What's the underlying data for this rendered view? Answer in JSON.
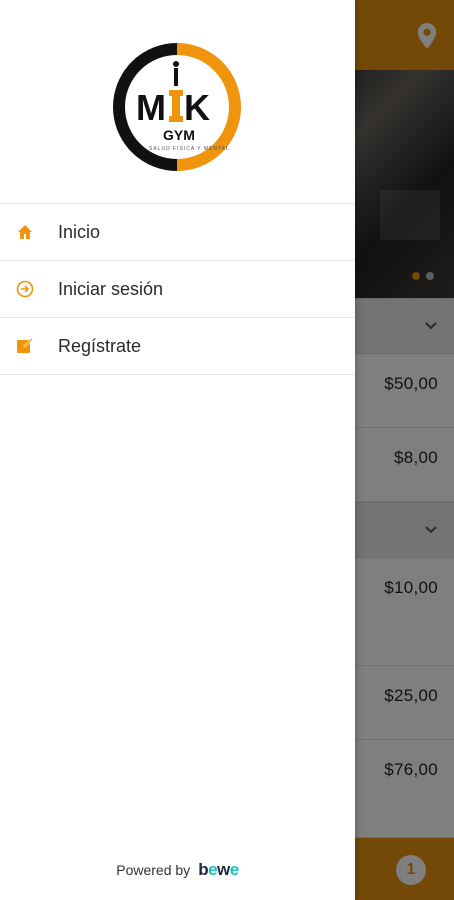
{
  "colors": {
    "accent": "#e8900c",
    "brand_teal": "#19c1c1"
  },
  "background": {
    "header_icon": "location-pin-icon",
    "carousel_dots": {
      "count": 2,
      "active_index": 0
    },
    "sections": [
      {
        "chevron": "chevron-down-icon",
        "prices": [
          "$50,00",
          "$8,00"
        ]
      },
      {
        "chevron": "chevron-down-icon",
        "prices": [
          "$10,00",
          "$25,00",
          "$76,00"
        ]
      }
    ],
    "cart_badge": "1"
  },
  "drawer": {
    "logo": {
      "text_main": "MIK",
      "text_sub": "GYM",
      "tagline": "SALUD FISICA Y MENTAL"
    },
    "menu": [
      {
        "label": "Inicio",
        "icon": "home-icon"
      },
      {
        "label": "Iniciar sesión",
        "icon": "login-icon"
      },
      {
        "label": "Regístrate",
        "icon": "register-icon"
      }
    ],
    "footer": {
      "powered_label": "Powered by",
      "brand_b": "b",
      "brand_e1": "e",
      "brand_w": "w",
      "brand_e2": "e"
    }
  }
}
